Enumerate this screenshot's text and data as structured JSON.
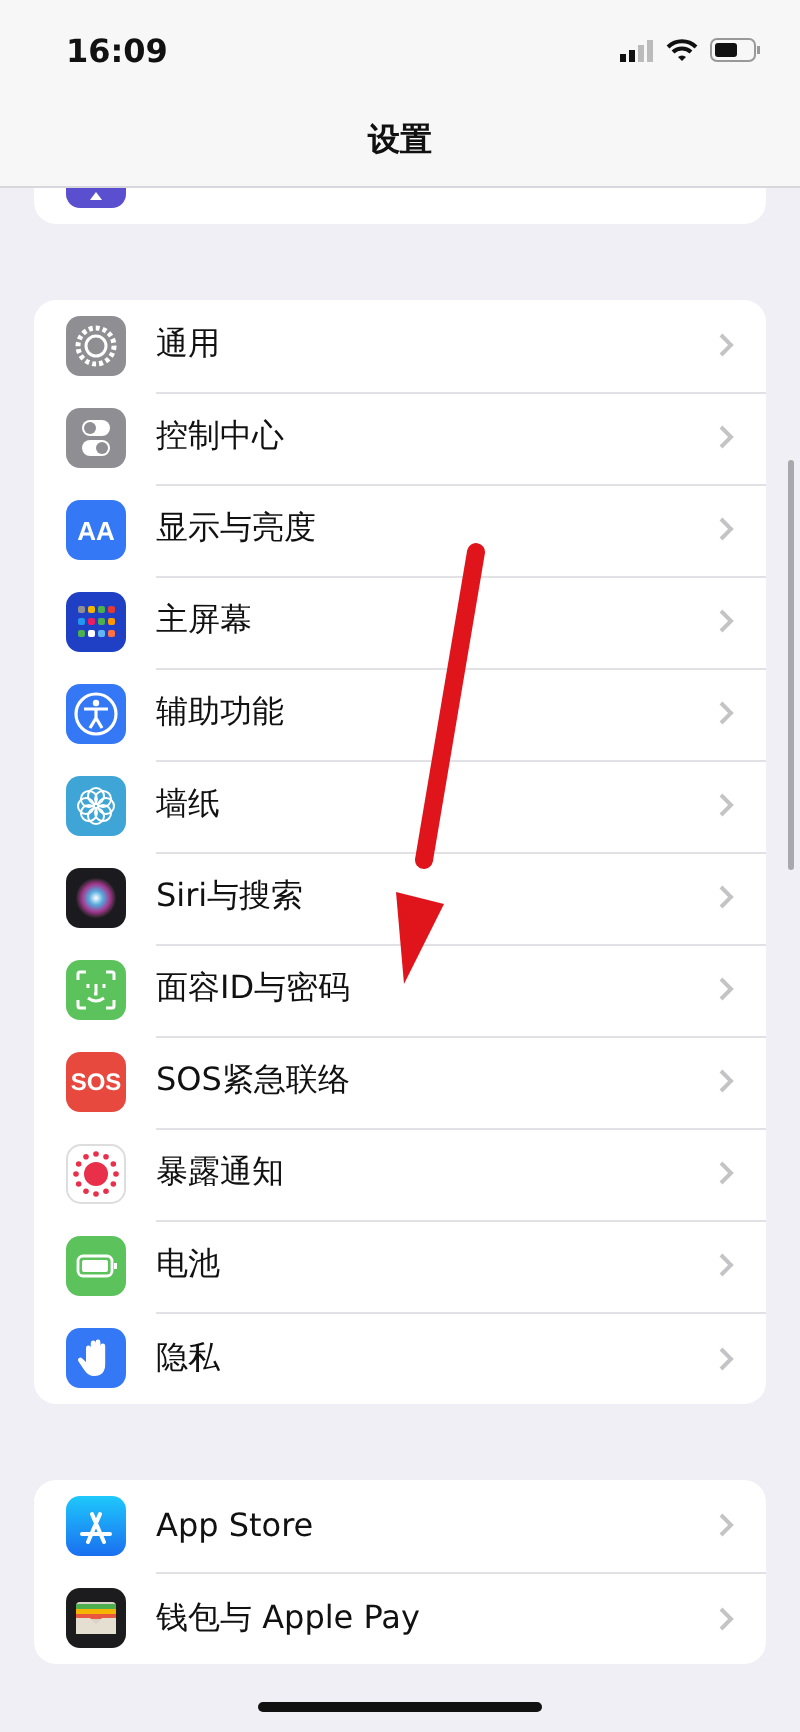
{
  "status_bar": {
    "time": "16:09"
  },
  "nav": {
    "title": "设置"
  },
  "groups": [
    {
      "items": [
        {
          "label": "通用"
        },
        {
          "label": "控制中心"
        },
        {
          "label": "显示与亮度",
          "icon_text": "AA"
        },
        {
          "label": "主屏幕"
        },
        {
          "label": "辅助功能"
        },
        {
          "label": "墙纸"
        },
        {
          "label": "Siri与搜索"
        },
        {
          "label": "面容ID与密码"
        },
        {
          "label": "SOS紧急联络",
          "icon_text": "SOS"
        },
        {
          "label": "暴露通知"
        },
        {
          "label": "电池"
        },
        {
          "label": "隐私"
        }
      ]
    },
    {
      "items": [
        {
          "label": "App Store"
        },
        {
          "label": "钱包与 Apple Pay"
        }
      ]
    }
  ]
}
